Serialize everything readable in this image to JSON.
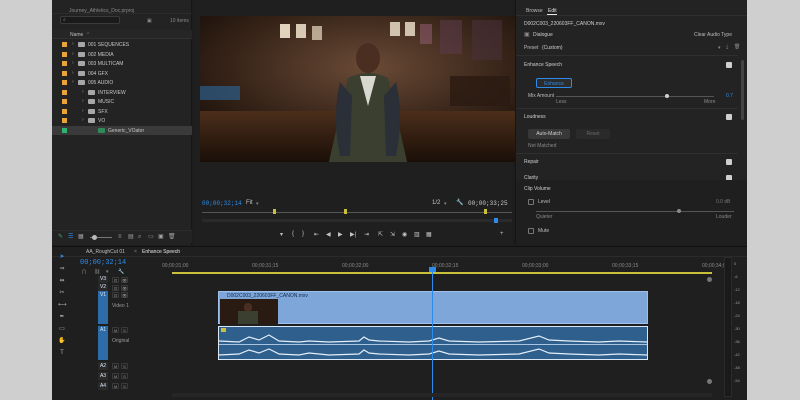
{
  "project": {
    "name": "Journey_Athletics_Doc.prproj",
    "item_count": "10 items",
    "column_name": "Name",
    "items": [
      {
        "label": "001 SEQUENCES",
        "color": "#e8a33b",
        "indent": 0
      },
      {
        "label": "002 MEDIA",
        "color": "#e8a33b",
        "indent": 0
      },
      {
        "label": "003 MULTICAM",
        "color": "#e8a33b",
        "indent": 0
      },
      {
        "label": "004 GFX",
        "color": "#e8a33b",
        "indent": 0
      },
      {
        "label": "005 AUDIO",
        "color": "#e8a33b",
        "indent": 0
      },
      {
        "label": "INTERVIEW",
        "color": "#e8a33b",
        "indent": 1
      },
      {
        "label": "MUSIC",
        "color": "#e8a33b",
        "indent": 1
      },
      {
        "label": "SFX",
        "color": "#e8a33b",
        "indent": 1
      },
      {
        "label": "VO",
        "color": "#e8a33b",
        "indent": 1
      },
      {
        "label": "Generic_VOator",
        "color": "#2fb36e",
        "indent": 2
      }
    ]
  },
  "program": {
    "timecode_current": "00;00;32;14",
    "fit": "Fit",
    "quality": "1/2",
    "timecode_duration": "00;00;33;25"
  },
  "sound": {
    "tab_browse": "Browse",
    "tab_edit": "Edit",
    "clip_name": "D002C003_220603FF_CANON.mxv",
    "dialogue_label": "Dialogue",
    "clear_audio_type": "Clear Audio Type",
    "preset_label": "Preset",
    "preset_value": "(Custom)",
    "enhance_speech": {
      "title": "Enhance Speech",
      "button": "Enhance",
      "mix_label": "Mix Amount",
      "mix_value": "0.7",
      "mix_fraction": 0.7,
      "low": "Less",
      "high": "More"
    },
    "loudness": {
      "title": "Loudness",
      "auto_match": "Auto-Match",
      "reset": "Reset",
      "status": "Not Matched"
    },
    "repair": "Repair",
    "clarity": "Clarity",
    "clip_volume": {
      "title": "Clip Volume",
      "level": "Level",
      "level_value": "0.0 dB",
      "level_fraction": 0.72,
      "quieter": "Quieter",
      "louder": "Louder",
      "mute": "Mute"
    }
  },
  "timeline": {
    "tab1": "AA_RoughCut 01",
    "tab2": "Enhance Speech",
    "timecode": "00;00;32;14",
    "ruler": [
      "00;00;31;00",
      "00;00;31;15",
      "00;00;32;00",
      "00;00;32;15",
      "00;00;33;00",
      "00;00;33;15",
      "00;00;34;00"
    ],
    "video_clip": "D002C003_220603FF_CANON.mxv",
    "video_track": "Video 1",
    "audio_track": "Original",
    "tracks": {
      "v3": "V3",
      "v2": "V2",
      "v1": "V1",
      "a1": "A1",
      "a2": "A2",
      "a3": "A3",
      "a4": "A4"
    },
    "meter_labels": [
      "0",
      "-6",
      "-12",
      "-18",
      "-24",
      "-30",
      "-36",
      "-42",
      "-48",
      "-54"
    ]
  },
  "colors": {
    "accent": "#2d8ceb",
    "clip_video": "#7fa6d9",
    "clip_audio": "#2f5f8c",
    "folder_label": "#e8a33b"
  }
}
